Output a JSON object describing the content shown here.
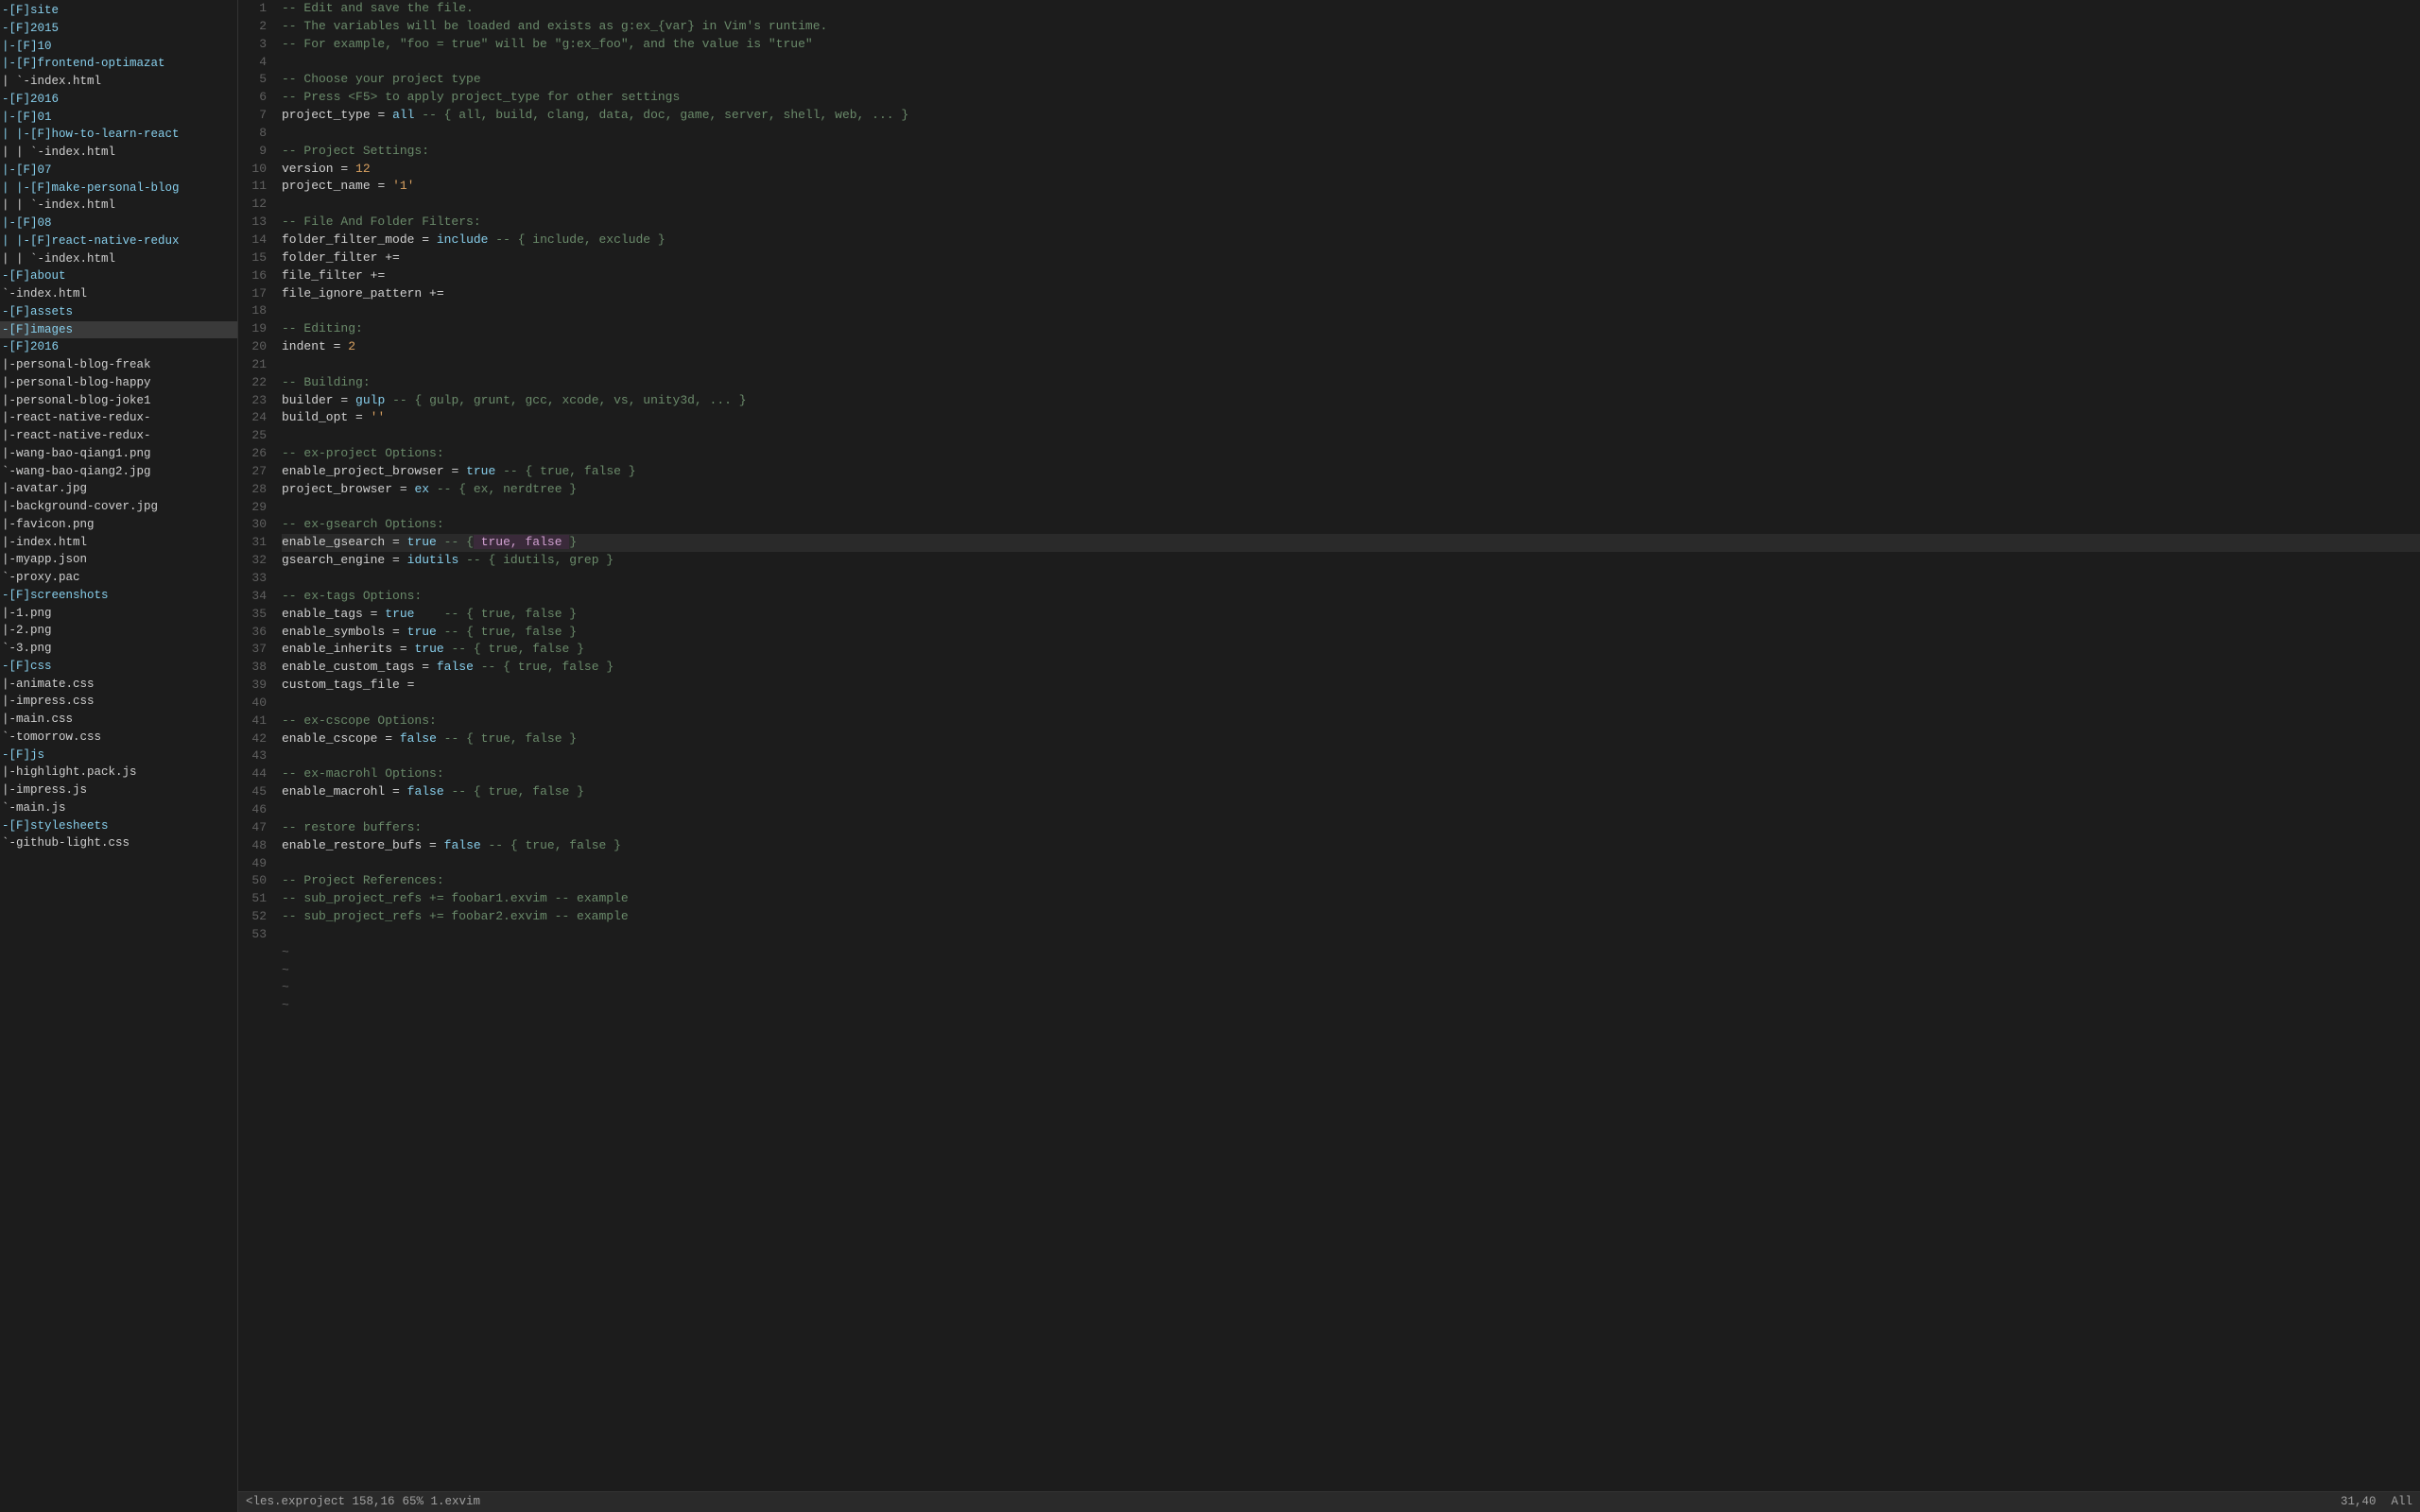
{
  "sidebar": {
    "items": [
      {
        "label": "-[F]site",
        "indent": 0,
        "type": "dir"
      },
      {
        "label": "-[F]2015",
        "indent": 1,
        "type": "dir"
      },
      {
        "label": "|-[F]10",
        "indent": 2,
        "type": "dir"
      },
      {
        "label": "  |-[F]frontend-optimazat",
        "indent": 3,
        "type": "dir"
      },
      {
        "label": "  | `-index.html",
        "indent": 4,
        "type": "file"
      },
      {
        "label": "-[F]2016",
        "indent": 1,
        "type": "dir"
      },
      {
        "label": " |-[F]01",
        "indent": 2,
        "type": "dir"
      },
      {
        "label": " | |-[F]how-to-learn-react",
        "indent": 3,
        "type": "dir"
      },
      {
        "label": " | | `-index.html",
        "indent": 4,
        "type": "file"
      },
      {
        "label": " |-[F]07",
        "indent": 2,
        "type": "dir"
      },
      {
        "label": " | |-[F]make-personal-blog",
        "indent": 3,
        "type": "dir"
      },
      {
        "label": " | | `-index.html",
        "indent": 4,
        "type": "file"
      },
      {
        "label": " |-[F]08",
        "indent": 2,
        "type": "dir"
      },
      {
        "label": " | |-[F]react-native-redux",
        "indent": 3,
        "type": "dir"
      },
      {
        "label": " | | `-index.html",
        "indent": 4,
        "type": "file"
      },
      {
        "label": "-[F]about",
        "indent": 1,
        "type": "dir"
      },
      {
        "label": " `-index.html",
        "indent": 2,
        "type": "file"
      },
      {
        "label": "-[F]assets",
        "indent": 1,
        "type": "dir"
      },
      {
        "label": " -[F]images",
        "indent": 2,
        "type": "dir",
        "selected": true
      },
      {
        "label": "  -[F]2016",
        "indent": 3,
        "type": "dir"
      },
      {
        "label": "   |-personal-blog-freak",
        "indent": 4,
        "type": "file"
      },
      {
        "label": "   |-personal-blog-happy",
        "indent": 4,
        "type": "file"
      },
      {
        "label": "   |-personal-blog-joke1",
        "indent": 4,
        "type": "file"
      },
      {
        "label": "   |-react-native-redux-",
        "indent": 4,
        "type": "file"
      },
      {
        "label": "   |-react-native-redux-",
        "indent": 4,
        "type": "file"
      },
      {
        "label": "   |-wang-bao-qiang1.png",
        "indent": 4,
        "type": "file"
      },
      {
        "label": "   `-wang-bao-qiang2.jpg",
        "indent": 4,
        "type": "file"
      },
      {
        "label": " |-avatar.jpg",
        "indent": 3,
        "type": "file"
      },
      {
        "label": " |-background-cover.jpg",
        "indent": 3,
        "type": "file"
      },
      {
        "label": " |-favicon.png",
        "indent": 3,
        "type": "file"
      },
      {
        "label": " |-index.html",
        "indent": 3,
        "type": "file"
      },
      {
        "label": " |-myapp.json",
        "indent": 3,
        "type": "file"
      },
      {
        "label": " `-proxy.pac",
        "indent": 3,
        "type": "file"
      },
      {
        "label": "-[F]screenshots",
        "indent": 2,
        "type": "dir"
      },
      {
        "label": " |-1.png",
        "indent": 3,
        "type": "file"
      },
      {
        "label": " |-2.png",
        "indent": 3,
        "type": "file"
      },
      {
        "label": " `-3.png",
        "indent": 3,
        "type": "file"
      },
      {
        "label": "-[F]css",
        "indent": 1,
        "type": "dir"
      },
      {
        "label": " |-animate.css",
        "indent": 2,
        "type": "file"
      },
      {
        "label": " |-impress.css",
        "indent": 2,
        "type": "file"
      },
      {
        "label": " |-main.css",
        "indent": 2,
        "type": "file"
      },
      {
        "label": " `-tomorrow.css",
        "indent": 2,
        "type": "file"
      },
      {
        "label": "-[F]js",
        "indent": 1,
        "type": "dir"
      },
      {
        "label": " |-highlight.pack.js",
        "indent": 2,
        "type": "file"
      },
      {
        "label": " |-impress.js",
        "indent": 2,
        "type": "file"
      },
      {
        "label": " `-main.js",
        "indent": 2,
        "type": "file"
      },
      {
        "label": "-[F]stylesheets",
        "indent": 1,
        "type": "dir"
      },
      {
        "label": " `-github-light.css",
        "indent": 2,
        "type": "file"
      }
    ]
  },
  "code": {
    "lines": [
      {
        "n": 1,
        "text": "-- Edit and save the file."
      },
      {
        "n": 2,
        "text": "-- The variables will be loaded and exists as g:ex_{var} in Vim's runtime."
      },
      {
        "n": 3,
        "text": "-- For example, \"foo = true\" will be \"g:ex_foo\", and the value is \"true\""
      },
      {
        "n": 4,
        "text": ""
      },
      {
        "n": 5,
        "text": "-- Choose your project type"
      },
      {
        "n": 6,
        "text": "-- Press <F5> to apply project_type for other settings"
      },
      {
        "n": 7,
        "text": "project_type = all -- { all, build, clang, data, doc, game, server, shell, web, ... }"
      },
      {
        "n": 8,
        "text": ""
      },
      {
        "n": 9,
        "text": "-- Project Settings:"
      },
      {
        "n": 10,
        "text": "version = 12"
      },
      {
        "n": 11,
        "text": "project_name = '1'"
      },
      {
        "n": 12,
        "text": ""
      },
      {
        "n": 13,
        "text": "-- File And Folder Filters:"
      },
      {
        "n": 14,
        "text": "folder_filter_mode = include -- { include, exclude }"
      },
      {
        "n": 15,
        "text": "folder_filter +="
      },
      {
        "n": 16,
        "text": "file_filter +="
      },
      {
        "n": 17,
        "text": "file_ignore_pattern +="
      },
      {
        "n": 18,
        "text": ""
      },
      {
        "n": 19,
        "text": "-- Editing:"
      },
      {
        "n": 20,
        "text": "indent = 2"
      },
      {
        "n": 21,
        "text": ""
      },
      {
        "n": 22,
        "text": "-- Building:"
      },
      {
        "n": 23,
        "text": "builder = gulp -- { gulp, grunt, gcc, xcode, vs, unity3d, ... }"
      },
      {
        "n": 24,
        "text": "build_opt = ''"
      },
      {
        "n": 25,
        "text": ""
      },
      {
        "n": 26,
        "text": "-- ex-project Options:"
      },
      {
        "n": 27,
        "text": "enable_project_browser = true -- { true, false }"
      },
      {
        "n": 28,
        "text": "project_browser = ex -- { ex, nerdtree }"
      },
      {
        "n": 29,
        "text": ""
      },
      {
        "n": 30,
        "text": "-- ex-gsearch Options:"
      },
      {
        "n": 31,
        "text": "enable_gsearch = true -- { true, false }"
      },
      {
        "n": 32,
        "text": "gsearch_engine = idutils -- { idutils, grep }"
      },
      {
        "n": 33,
        "text": ""
      },
      {
        "n": 34,
        "text": "-- ex-tags Options:"
      },
      {
        "n": 35,
        "text": "enable_tags = true    -- { true, false }"
      },
      {
        "n": 36,
        "text": "enable_symbols = true -- { true, false }"
      },
      {
        "n": 37,
        "text": "enable_inherits = true -- { true, false }"
      },
      {
        "n": 38,
        "text": "enable_custom_tags = false -- { true, false }"
      },
      {
        "n": 39,
        "text": "custom_tags_file ="
      },
      {
        "n": 40,
        "text": ""
      },
      {
        "n": 41,
        "text": "-- ex-cscope Options:"
      },
      {
        "n": 42,
        "text": "enable_cscope = false -- { true, false }"
      },
      {
        "n": 43,
        "text": ""
      },
      {
        "n": 44,
        "text": "-- ex-macrohl Options:"
      },
      {
        "n": 45,
        "text": "enable_macrohl = false -- { true, false }"
      },
      {
        "n": 46,
        "text": ""
      },
      {
        "n": 47,
        "text": "-- restore buffers:"
      },
      {
        "n": 48,
        "text": "enable_restore_bufs = false -- { true, false }"
      },
      {
        "n": 49,
        "text": ""
      },
      {
        "n": 50,
        "text": "-- Project References:"
      },
      {
        "n": 51,
        "text": "-- sub_project_refs += foobar1.exvim -- example"
      },
      {
        "n": 52,
        "text": "-- sub_project_refs += foobar2.exvim -- example"
      },
      {
        "n": 53,
        "text": ""
      }
    ],
    "tilde_lines": [
      "~",
      "~",
      "~",
      "~"
    ]
  },
  "status": {
    "left": "<les.exproject  158,16",
    "center": "65%  1.exvim",
    "right": "31,40",
    "mode": "All"
  }
}
